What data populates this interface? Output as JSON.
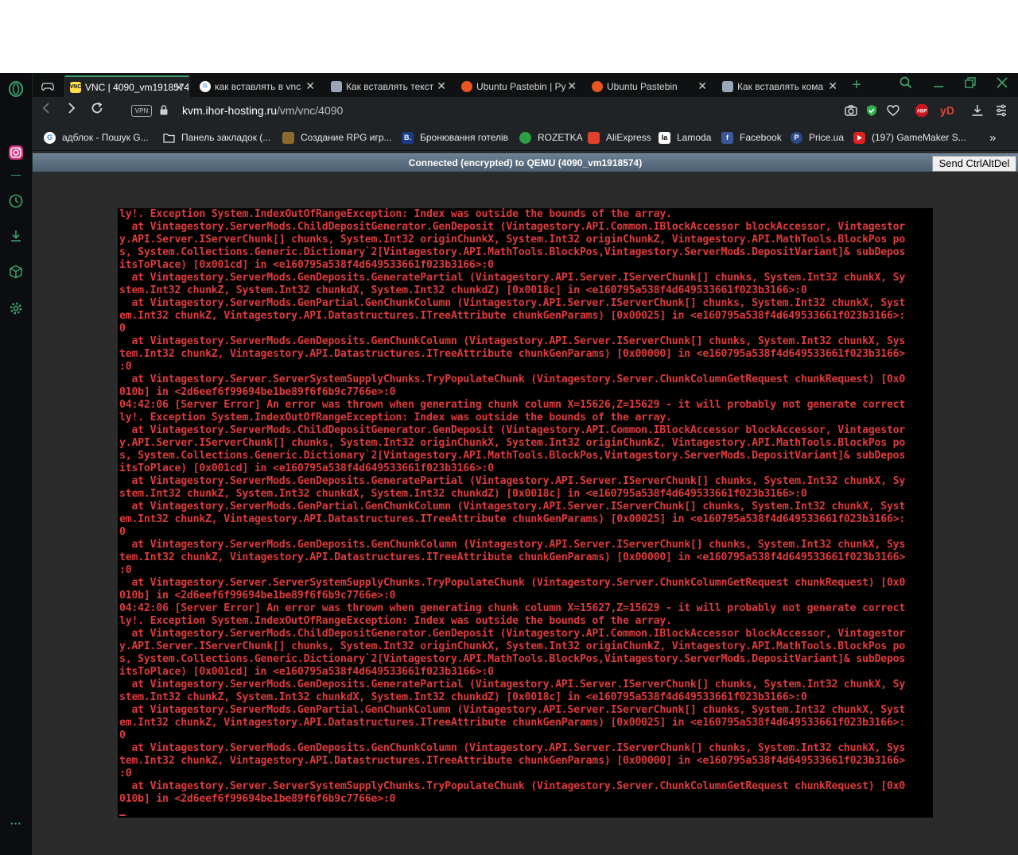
{
  "colors": {
    "accent": "#3ea36a",
    "console_text": "#dd3b3b",
    "console_bg": "#000000"
  },
  "sidebar": {
    "items": [
      {
        "icon": "opera-logo-icon"
      },
      {
        "icon": "instagram-icon"
      },
      {
        "icon": "clock-history-icon"
      },
      {
        "icon": "download-icon"
      },
      {
        "icon": "cube-icon"
      },
      {
        "icon": "gear-icon"
      },
      {
        "icon": "more-dots-icon",
        "label": "···"
      }
    ]
  },
  "tabs": [
    {
      "title": "VNC | 4090_vm1918574",
      "icon": "vnc-favicon",
      "fav_text": "VNC",
      "active": true
    },
    {
      "title": "как вставлять в vnc",
      "icon": "google-favicon",
      "fav_text": "G"
    },
    {
      "title": "Как вставлять текст",
      "icon": "page-favicon",
      "fav_text": ""
    },
    {
      "title": "Ubuntu Pastebin | Ру",
      "icon": "ubuntu-favicon",
      "fav_text": ""
    },
    {
      "title": "Ubuntu Pastebin",
      "icon": "ubuntu-favicon",
      "fav_text": ""
    },
    {
      "title": "Как вставлять кома",
      "icon": "page-favicon",
      "fav_text": ""
    }
  ],
  "tabbar": {
    "new_tab": "+",
    "close": "✕"
  },
  "navbar": {
    "vpn": "VPN",
    "url_host": "kvm.ihor-hosting.ru",
    "url_path": "/vm/vnc/4090"
  },
  "toolbar": {
    "abp": "ABP",
    "yd": "yD"
  },
  "bookmarks": [
    {
      "label": "адблок - Пошук G...",
      "icon": "google-icon",
      "fav_text": "G",
      "color": "#ffffff"
    },
    {
      "label": "Панель закладок (...",
      "icon": "folder-icon",
      "fav_text": "",
      "color": "#202326"
    },
    {
      "label": "Создание RPG игр...",
      "icon": "rpg-icon",
      "fav_text": "",
      "color": "#8a6a2e"
    },
    {
      "label": "Бронювання готелів",
      "icon": "booking-icon",
      "fav_text": "B.",
      "color": "#1a3a8a"
    },
    {
      "label": "ROZETKA",
      "icon": "rozetka-icon",
      "fav_text": "",
      "color": "#2f9e44"
    },
    {
      "label": "AliExpress",
      "icon": "aliexpress-icon",
      "fav_text": "",
      "color": "#e0412d"
    },
    {
      "label": "Lamoda",
      "icon": "lamoda-icon",
      "fav_text": "la",
      "color": "#ffffff"
    },
    {
      "label": "Facebook",
      "icon": "facebook-icon",
      "fav_text": "f",
      "color": "#3b5998"
    },
    {
      "label": "Price.ua",
      "icon": "priceua-icon",
      "fav_text": "P",
      "color": "#2c4a8a"
    },
    {
      "label": "(197) GameMaker S...",
      "icon": "youtube-icon",
      "fav_text": "",
      "color": "#e02020"
    }
  ],
  "bookmarks_more": "»",
  "vnc": {
    "status": "Connected (encrypted) to QEMU (4090_vm1918574)",
    "send_ctrl_alt_del": "Send CtrlAltDel"
  },
  "console": {
    "lines": [
      "ly!. Exception System.IndexOutOfRangeException: Index was outside the bounds of the array.",
      "  at Vintagestory.ServerMods.ChildDepositGenerator.GenDeposit (Vintagestory.API.Common.IBlockAccessor blockAccessor, Vintagestor",
      "y.API.Server.IServerChunk[] chunks, System.Int32 originChunkX, System.Int32 originChunkZ, Vintagestory.API.MathTools.BlockPos po",
      "s, System.Collections.Generic.Dictionary`2[Vintagestory.API.MathTools.BlockPos,Vintagestory.ServerMods.DepositVariant]& subDepos",
      "itsToPlace) [0x001cd] in <e160795a538f4d649533661f023b3166>:0",
      "  at Vintagestory.ServerMods.GenDeposits.GeneratePartial (Vintagestory.API.Server.IServerChunk[] chunks, System.Int32 chunkX, Sy",
      "stem.Int32 chunkZ, System.Int32 chunkdX, System.Int32 chunkdZ) [0x0018c] in <e160795a538f4d649533661f023b3166>:0",
      "  at Vintagestory.ServerMods.GenPartial.GenChunkColumn (Vintagestory.API.Server.IServerChunk[] chunks, System.Int32 chunkX, Syst",
      "em.Int32 chunkZ, Vintagestory.API.Datastructures.ITreeAttribute chunkGenParams) [0x00025] in <e160795a538f4d649533661f023b3166>:",
      "0",
      "  at Vintagestory.ServerMods.GenDeposits.GenChunkColumn (Vintagestory.API.Server.IServerChunk[] chunks, System.Int32 chunkX, Sys",
      "tem.Int32 chunkZ, Vintagestory.API.Datastructures.ITreeAttribute chunkGenParams) [0x00000] in <e160795a538f4d649533661f023b3166>",
      ":0",
      "  at Vintagestory.Server.ServerSystemSupplyChunks.TryPopulateChunk (Vintagestory.Server.ChunkColumnGetRequest chunkRequest) [0x0",
      "010b] in <2d6eef6f99694be1be89f6f6b9c7766e>:0",
      "04:42:06 [Server Error] An error was thrown when generating chunk column X=15626,Z=15629 - it will probably not generate correct",
      "ly!. Exception System.IndexOutOfRangeException: Index was outside the bounds of the array.",
      "  at Vintagestory.ServerMods.ChildDepositGenerator.GenDeposit (Vintagestory.API.Common.IBlockAccessor blockAccessor, Vintagestor",
      "y.API.Server.IServerChunk[] chunks, System.Int32 originChunkX, System.Int32 originChunkZ, Vintagestory.API.MathTools.BlockPos po",
      "s, System.Collections.Generic.Dictionary`2[Vintagestory.API.MathTools.BlockPos,Vintagestory.ServerMods.DepositVariant]& subDepos",
      "itsToPlace) [0x001cd] in <e160795a538f4d649533661f023b3166>:0",
      "  at Vintagestory.ServerMods.GenDeposits.GeneratePartial (Vintagestory.API.Server.IServerChunk[] chunks, System.Int32 chunkX, Sy",
      "stem.Int32 chunkZ, System.Int32 chunkdX, System.Int32 chunkdZ) [0x0018c] in <e160795a538f4d649533661f023b3166>:0",
      "  at Vintagestory.ServerMods.GenPartial.GenChunkColumn (Vintagestory.API.Server.IServerChunk[] chunks, System.Int32 chunkX, Syst",
      "em.Int32 chunkZ, Vintagestory.API.Datastructures.ITreeAttribute chunkGenParams) [0x00025] in <e160795a538f4d649533661f023b3166>:",
      "0",
      "  at Vintagestory.ServerMods.GenDeposits.GenChunkColumn (Vintagestory.API.Server.IServerChunk[] chunks, System.Int32 chunkX, Sys",
      "tem.Int32 chunkZ, Vintagestory.API.Datastructures.ITreeAttribute chunkGenParams) [0x00000] in <e160795a538f4d649533661f023b3166>",
      ":0",
      "  at Vintagestory.Server.ServerSystemSupplyChunks.TryPopulateChunk (Vintagestory.Server.ChunkColumnGetRequest chunkRequest) [0x0",
      "010b] in <2d6eef6f99694be1be89f6f6b9c7766e>:0",
      "04:42:06 [Server Error] An error was thrown when generating chunk column X=15627,Z=15629 - it will probably not generate correct",
      "ly!. Exception System.IndexOutOfRangeException: Index was outside the bounds of the array.",
      "  at Vintagestory.ServerMods.ChildDepositGenerator.GenDeposit (Vintagestory.API.Common.IBlockAccessor blockAccessor, Vintagestor",
      "y.API.Server.IServerChunk[] chunks, System.Int32 originChunkX, System.Int32 originChunkZ, Vintagestory.API.MathTools.BlockPos po",
      "s, System.Collections.Generic.Dictionary`2[Vintagestory.API.MathTools.BlockPos,Vintagestory.ServerMods.DepositVariant]& subDepos",
      "itsToPlace) [0x001cd] in <e160795a538f4d649533661f023b3166>:0",
      "  at Vintagestory.ServerMods.GenDeposits.GeneratePartial (Vintagestory.API.Server.IServerChunk[] chunks, System.Int32 chunkX, Sy",
      "stem.Int32 chunkZ, System.Int32 chunkdX, System.Int32 chunkdZ) [0x0018c] in <e160795a538f4d649533661f023b3166>:0",
      "  at Vintagestory.ServerMods.GenPartial.GenChunkColumn (Vintagestory.API.Server.IServerChunk[] chunks, System.Int32 chunkX, Syst",
      "em.Int32 chunkZ, Vintagestory.API.Datastructures.ITreeAttribute chunkGenParams) [0x00025] in <e160795a538f4d649533661f023b3166>:",
      "0",
      "  at Vintagestory.ServerMods.GenDeposits.GenChunkColumn (Vintagestory.API.Server.IServerChunk[] chunks, System.Int32 chunkX, Sys",
      "tem.Int32 chunkZ, Vintagestory.API.Datastructures.ITreeAttribute chunkGenParams) [0x00000] in <e160795a538f4d649533661f023b3166>",
      ":0",
      "  at Vintagestory.Server.ServerSystemSupplyChunks.TryPopulateChunk (Vintagestory.Server.ChunkColumnGetRequest chunkRequest) [0x0",
      "010b] in <2d6eef6f99694be1be89f6f6b9c7766e>:0"
    ]
  }
}
